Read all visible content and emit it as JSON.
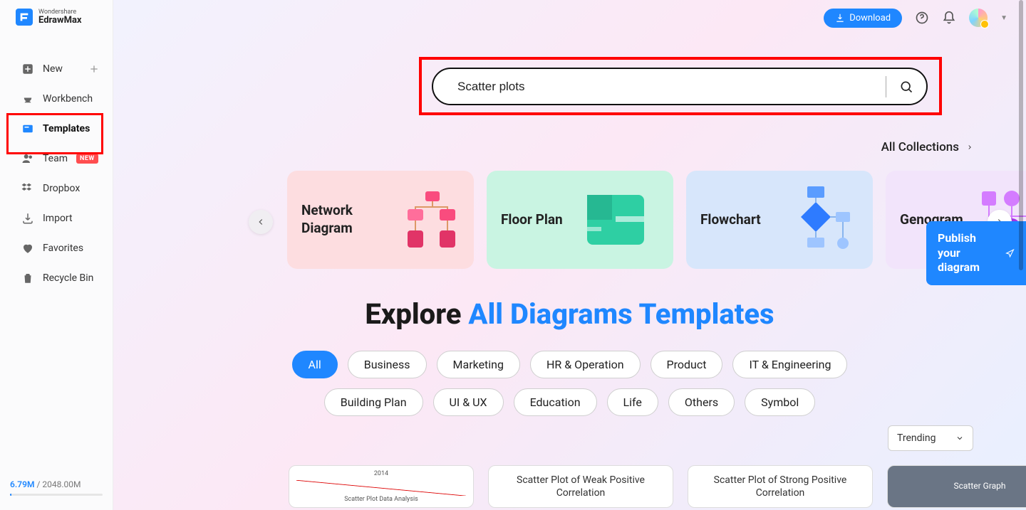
{
  "brand": {
    "company": "Wondershare",
    "product": "EdrawMax"
  },
  "topbar": {
    "download_label": "Download"
  },
  "sidebar": {
    "items": [
      {
        "label": "New",
        "icon": "new-icon",
        "has_plus": true
      },
      {
        "label": "Workbench",
        "icon": "workbench-icon"
      },
      {
        "label": "Templates",
        "icon": "templates-icon",
        "active": true
      },
      {
        "label": "Team",
        "icon": "team-icon",
        "badge": "NEW"
      },
      {
        "label": "Dropbox",
        "icon": "dropbox-icon"
      },
      {
        "label": "Import",
        "icon": "import-icon"
      },
      {
        "label": "Favorites",
        "icon": "favorites-icon"
      },
      {
        "label": "Recycle Bin",
        "icon": "recycle-icon"
      }
    ]
  },
  "storage": {
    "used": "6.79M",
    "total": "2048.00M",
    "separator": " / "
  },
  "search": {
    "value": "Scatter plots"
  },
  "collections_link": "All Collections",
  "categories": [
    {
      "label": "Network Diagram",
      "style": "network"
    },
    {
      "label": "Floor  Plan",
      "style": "floor"
    },
    {
      "label": "Flowchart",
      "style": "flow"
    },
    {
      "label": "Genogram",
      "style": "geno"
    }
  ],
  "publish": {
    "text": "Publish your diagram"
  },
  "explore": {
    "prefix": "Explore ",
    "accent": "All Diagrams Templates"
  },
  "pills": [
    {
      "label": "All",
      "active": true
    },
    {
      "label": "Business"
    },
    {
      "label": "Marketing"
    },
    {
      "label": "HR & Operation"
    },
    {
      "label": "Product"
    },
    {
      "label": "IT & Engineering"
    },
    {
      "label": "Building Plan"
    },
    {
      "label": "UI & UX"
    },
    {
      "label": "Education"
    },
    {
      "label": "Life"
    },
    {
      "label": "Others"
    },
    {
      "label": "Symbol"
    }
  ],
  "sort": {
    "selected": "Trending"
  },
  "results": [
    {
      "title": "Scatter Plot Data Analysis",
      "kind": "mini-chart",
      "year": "2014"
    },
    {
      "title": "Scatter Plot of Weak Positive Correlation",
      "kind": "text"
    },
    {
      "title": "Scatter Plot of Strong Positive Correlation",
      "kind": "text"
    },
    {
      "title": "Scatter Graph",
      "kind": "graphic"
    }
  ]
}
